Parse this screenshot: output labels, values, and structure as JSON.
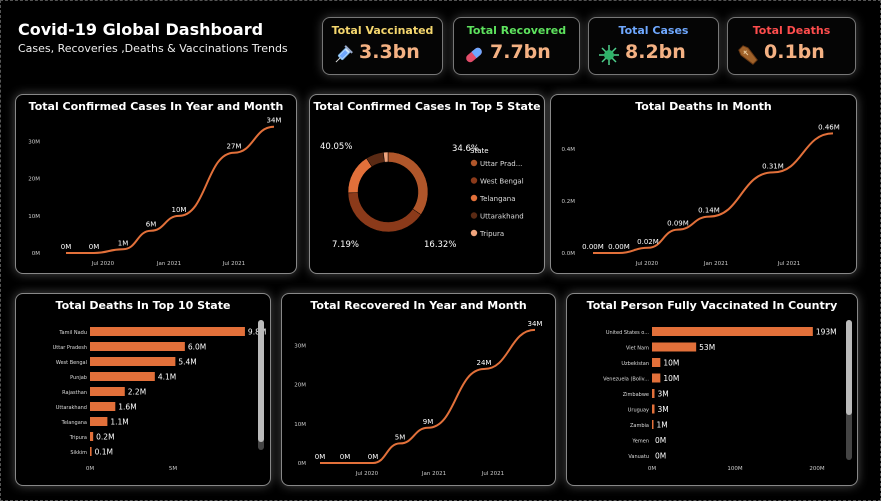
{
  "header": {
    "title": "Covid-19 Global Dashboard",
    "subtitle": "Cases, Recoveries ,Deaths & Vaccinations Trends"
  },
  "kpis": [
    {
      "label": "Total Vaccinated",
      "value": "3.3bn",
      "label_color": "#f5d76e",
      "icon": "syringe-icon"
    },
    {
      "label": "Total Recovered",
      "value": "7.7bn",
      "label_color": "#5ee35e",
      "icon": "pill-icon"
    },
    {
      "label": "Total Cases",
      "value": "8.2bn",
      "label_color": "#6fa8ff",
      "icon": "virus-icon"
    },
    {
      "label": "Total Deaths",
      "value": "0.1bn",
      "label_color": "#ff4d4d",
      "icon": "coffin-icon"
    }
  ],
  "colors": {
    "accent": "#e2703a",
    "kpi_value": "#f4b183"
  },
  "chart_data": [
    {
      "id": "cases",
      "type": "line",
      "title": "Total Confirmed Cases In Year and Month",
      "y_ticks": [
        "0M",
        "10M",
        "20M",
        "30M"
      ],
      "x_ticks": [
        "Jul 2020",
        "Jan 2021",
        "Jul 2021"
      ],
      "ylim": [
        0,
        35
      ],
      "values": [
        0,
        0,
        1,
        6,
        10,
        27,
        34
      ],
      "data_labels": [
        "0M",
        "0M",
        "1M",
        "6M",
        "10M",
        "27M",
        "34M"
      ]
    },
    {
      "id": "donut",
      "type": "pie",
      "title": "Total Confirmed Cases In Top 5 State",
      "legend_title": "State",
      "categories": [
        "Uttar Prad...",
        "West Bengal",
        "Telangana",
        "Uttarakhand",
        "Tripura"
      ],
      "values": [
        34.6,
        40.05,
        16.32,
        7.19,
        1.84
      ],
      "colors": [
        "#b0562a",
        "#8b3a1a",
        "#e2703a",
        "#5a2a14",
        "#f0a47d"
      ],
      "data_labels": [
        "34.6%",
        "40.05%",
        "16.32%",
        "7.19%"
      ]
    },
    {
      "id": "deaths",
      "type": "line",
      "title": "Total Deaths In Month",
      "y_ticks": [
        "0.0M",
        "0.2M",
        "0.4M"
      ],
      "x_ticks": [
        "Jul 2020",
        "Jan 2021",
        "Jul 2021"
      ],
      "ylim": [
        0,
        0.5
      ],
      "values": [
        0,
        0,
        0.02,
        0.09,
        0.14,
        0.31,
        0.46
      ],
      "data_labels": [
        "0.00M",
        "0.00M",
        "0.02M",
        "0.09M",
        "0.14M",
        "0.31M",
        "0.46M"
      ]
    },
    {
      "id": "state_deaths",
      "type": "bar",
      "title": "Total Deaths In Top 10 State",
      "categories": [
        "Tamil Nadu",
        "Uttar Pradesh",
        "West Bengal",
        "Punjab",
        "Rajasthan",
        "Uttarakhand",
        "Telangana",
        "Tripura",
        "Sikkim"
      ],
      "values": [
        9.8,
        6.0,
        5.4,
        4.1,
        2.2,
        1.6,
        1.1,
        0.2,
        0.1
      ],
      "data_labels": [
        "9.8M",
        "6.0M",
        "5.4M",
        "4.1M",
        "2.2M",
        "1.6M",
        "1.1M",
        "0.2M",
        "0.1M"
      ],
      "x_ticks": [
        "0M",
        "5M"
      ],
      "xlim": [
        0,
        10.5
      ]
    },
    {
      "id": "recovered",
      "type": "line",
      "title": "Total Recovered In Year and Month",
      "y_ticks": [
        "0M",
        "10M",
        "20M",
        "30M"
      ],
      "x_ticks": [
        "Jul 2020",
        "Jan 2021",
        "Jul 2021"
      ],
      "ylim": [
        0,
        35
      ],
      "values": [
        0,
        0,
        0,
        5,
        9,
        24,
        34
      ],
      "data_labels": [
        "0M",
        "0M",
        "0M",
        "5M",
        "9M",
        "24M",
        "34M"
      ]
    },
    {
      "id": "vaccinated",
      "type": "bar",
      "title": "Total Person Fully Vaccinated In Country",
      "categories": [
        "United States o...",
        "Viet Nam",
        "Uzbekistan",
        "Venezuela (Boliv...",
        "Zimbabwe",
        "Uruguay",
        "Zambia",
        "Yemen",
        "Vanuatu"
      ],
      "values": [
        193,
        53,
        10,
        10,
        3,
        3,
        1,
        0,
        0
      ],
      "data_labels": [
        "193M",
        "53M",
        "10M",
        "10M",
        "3M",
        "3M",
        "1M",
        "0M",
        "0M"
      ],
      "x_ticks": [
        "0M",
        "100M",
        "200M"
      ],
      "xlim": [
        0,
        210
      ]
    }
  ]
}
